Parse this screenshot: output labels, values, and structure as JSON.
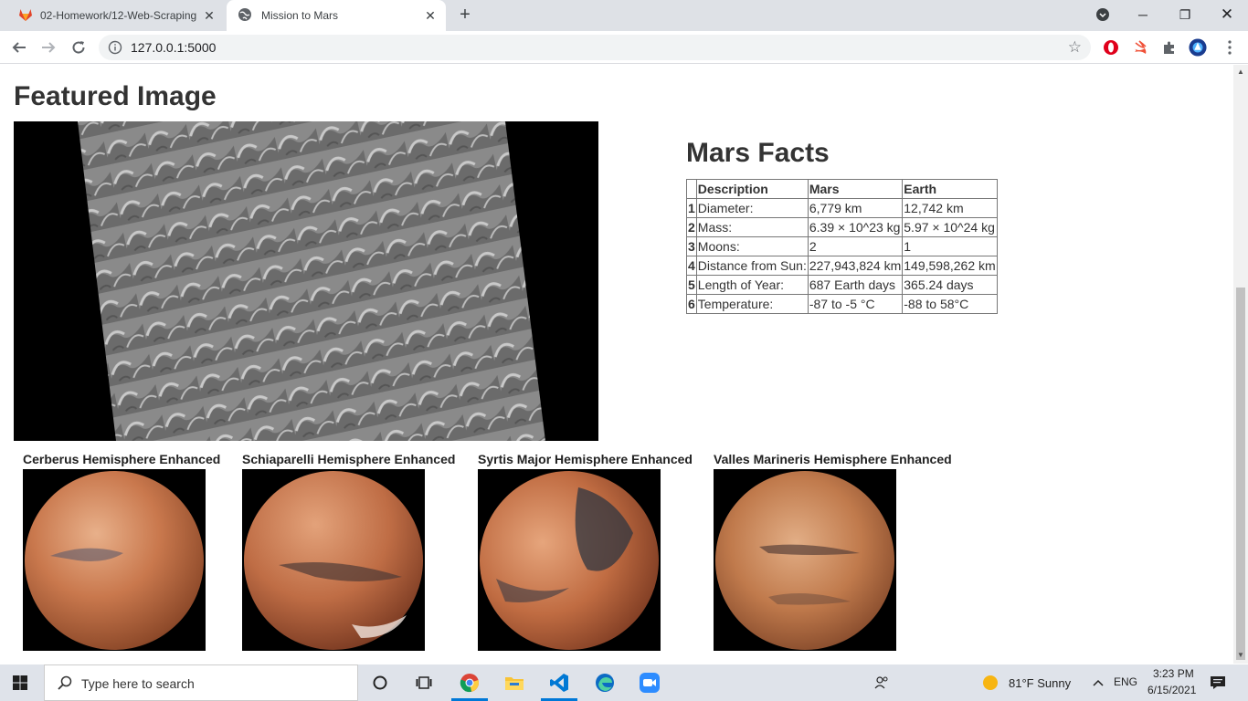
{
  "browser": {
    "tabs": [
      {
        "title": "02-Homework/12-Web-Scraping",
        "active": false
      },
      {
        "title": "Mission to Mars",
        "active": true
      }
    ],
    "url": "127.0.0.1:5000"
  },
  "page": {
    "featured_heading": "Featured Image",
    "facts_heading": "Mars Facts",
    "facts_table": {
      "headers": [
        "",
        "Description",
        "Mars",
        "Earth"
      ],
      "rows": [
        [
          "1",
          "Diameter:",
          "6,779 km",
          "12,742 km"
        ],
        [
          "2",
          "Mass:",
          "6.39 × 10^23 kg",
          "5.97 × 10^24 kg"
        ],
        [
          "3",
          "Moons:",
          "2",
          "1"
        ],
        [
          "4",
          "Distance from Sun:",
          "227,943,824 km",
          "149,598,262 km"
        ],
        [
          "5",
          "Length of Year:",
          "687 Earth days",
          "365.24 days"
        ],
        [
          "6",
          "Temperature:",
          "-87 to -5 °C",
          "-88 to 58°C"
        ]
      ]
    },
    "hemispheres": [
      {
        "title": "Cerberus Hemisphere Enhanced"
      },
      {
        "title": "Schiaparelli Hemisphere Enhanced"
      },
      {
        "title": "Syrtis Major Hemisphere Enhanced"
      },
      {
        "title": "Valles Marineris Hemisphere Enhanced"
      }
    ]
  },
  "taskbar": {
    "search_placeholder": "Type here to search",
    "weather": "81°F  Sunny",
    "language": "ENG",
    "time": "3:23 PM",
    "date": "6/15/2021"
  }
}
